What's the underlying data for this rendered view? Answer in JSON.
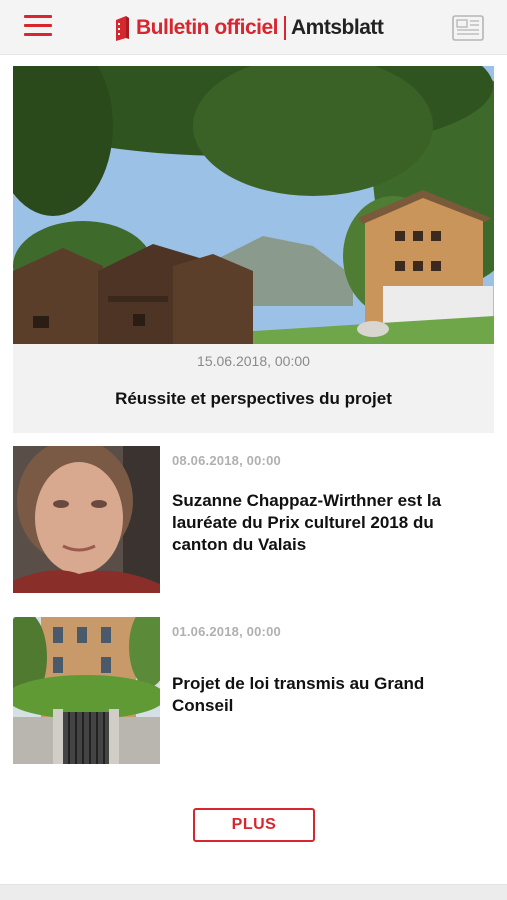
{
  "header": {
    "logo_primary": "Bulletin officiel",
    "logo_secondary": "Amtsblatt",
    "brand_color": "#d8262e",
    "menu_icon": "hamburger-icon",
    "news_icon": "newspaper-icon"
  },
  "featured": {
    "date": "15.06.2018, 00:00",
    "title": "Réussite et perspectives du projet",
    "image": "village-chalets-photo"
  },
  "articles": [
    {
      "date": "08.06.2018, 00:00",
      "title": "Suzanne Chappaz-Wirthner est la lauréate  du Prix culturel 2018 du canton du Valais",
      "image": "portrait-photo"
    },
    {
      "date": "01.06.2018, 00:00",
      "title": "Projet de loi transmis au Grand Conseil",
      "image": "building-gate-photo"
    }
  ],
  "more_button": {
    "label": "PLUS"
  }
}
